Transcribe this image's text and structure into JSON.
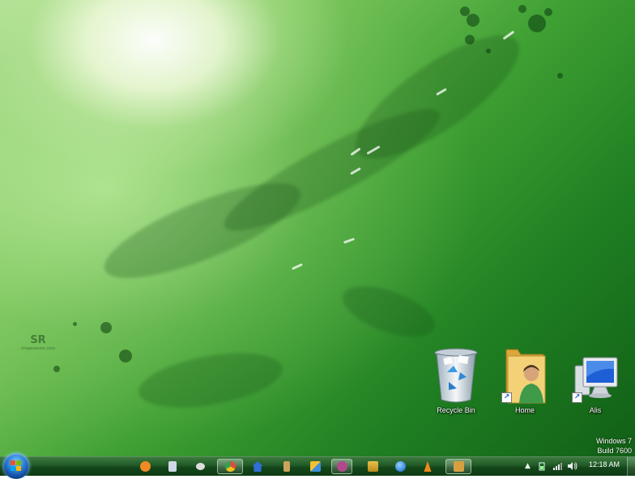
{
  "desktop": {
    "watermark_mark": "SR",
    "watermark_text": "shapeseven.com",
    "icons": [
      {
        "label": "Recycle Bin"
      },
      {
        "label": "Home"
      },
      {
        "label": "Alis"
      }
    ],
    "os_line1": "Windows 7",
    "os_line2": "Build 7600"
  },
  "taskbar": {
    "start_icon": "windows-logo-icon",
    "pinned": [
      {
        "name": "blender-icon",
        "color": "#f08a24"
      },
      {
        "name": "document-icon",
        "color": "#cfd8e6"
      },
      {
        "name": "webcam-icon",
        "color": "#dddddd"
      },
      {
        "name": "chrome-icon",
        "color": "#e64a3b"
      },
      {
        "name": "house-icon",
        "color": "#2f6fd6"
      },
      {
        "name": "paint-brush-icon",
        "color": "#c9a45a"
      },
      {
        "name": "picture-icon",
        "color": "#f2c230"
      },
      {
        "name": "tool-icon",
        "color": "#b04a8c"
      },
      {
        "name": "windows-explorer-icon",
        "color": "#e9c14a"
      },
      {
        "name": "network-globe-icon",
        "color": "#3d8fe0"
      },
      {
        "name": "vlc-cone-icon",
        "color": "#f08a1a"
      },
      {
        "name": "media-tool-icon",
        "color": "#d6a040"
      }
    ],
    "tray": {
      "arrow": "▲",
      "clock": "12:18 AM"
    }
  }
}
